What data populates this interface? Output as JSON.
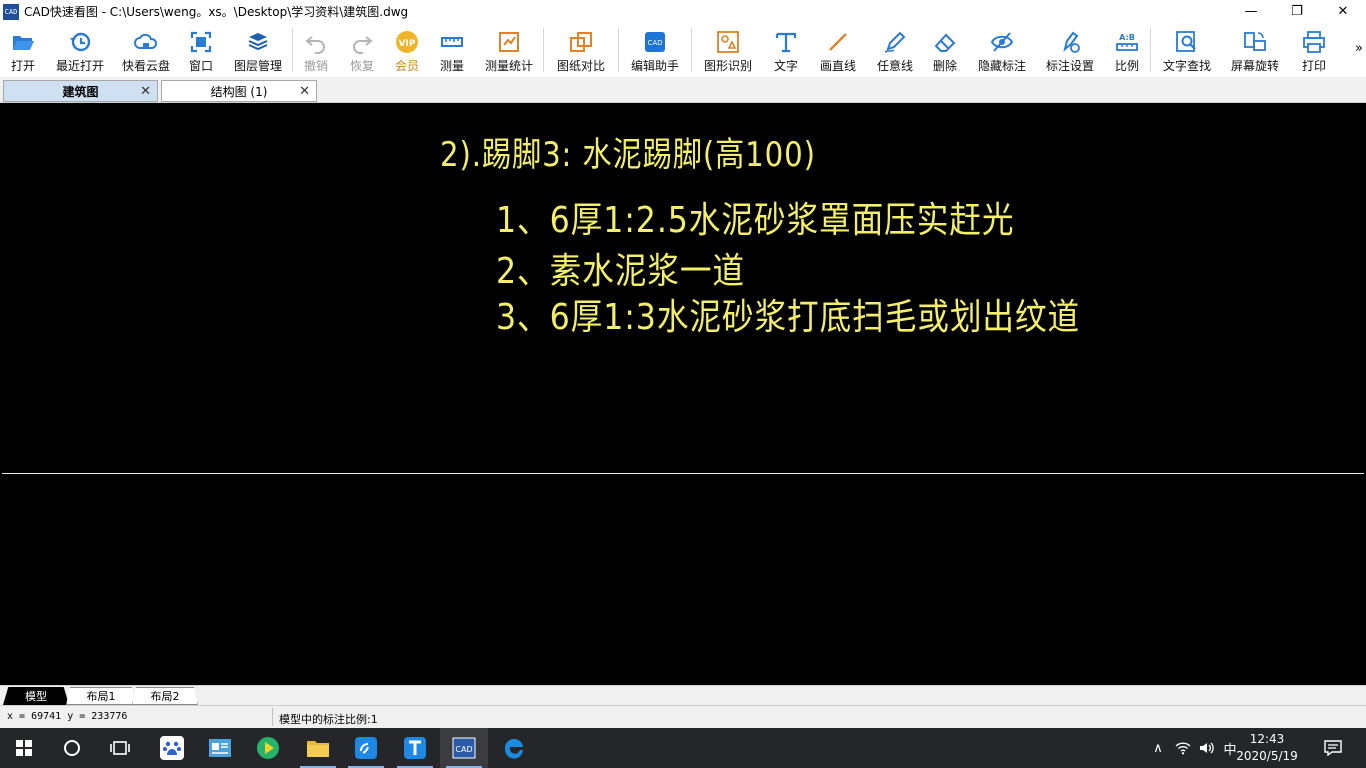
{
  "window": {
    "app_icon_text": "CAD",
    "title": "CAD快速看图 - C:\\Users\\weng。xs。\\Desktop\\学习资料\\建筑图.dwg",
    "minimize": "—",
    "maximize": "❐",
    "close": "✕"
  },
  "toolbar": {
    "open": "打开",
    "recent": "最近打开",
    "cloud": "快看云盘",
    "window": "窗口",
    "layers": "图层管理",
    "undo": "撤销",
    "redo": "恢复",
    "vip": "会员",
    "measure": "测量",
    "measure_stats": "测量统计",
    "compare": "图纸对比",
    "edit_assistant": "编辑助手",
    "shape_recognize": "图形识别",
    "text": "文字",
    "draw_line": "画直线",
    "freehand": "任意线",
    "delete": "删除",
    "hide_annotation": "隐藏标注",
    "annotation_settings": "标注设置",
    "scale": "比例",
    "text_search": "文字查找",
    "screen_rotate": "屏幕旋转",
    "print": "打印",
    "more": "»"
  },
  "doc_tabs": [
    {
      "label": "建筑图",
      "active": true
    },
    {
      "label": "结构图 (1)",
      "active": false
    }
  ],
  "drawing": {
    "title": "2).踢脚3: 水泥踢脚(高100)",
    "line1": "1、6厚1:2.5水泥砂浆罩面压实赶光",
    "line2": "2、素水泥浆一道",
    "line3": "3、6厚1:3水泥砂浆打底扫毛或划出纹道",
    "text_color": "#f3ef6a"
  },
  "layout_tabs": [
    {
      "label": "模型",
      "active": true
    },
    {
      "label": "布局1",
      "active": false
    },
    {
      "label": "布局2",
      "active": false
    }
  ],
  "status": {
    "coords": "x = 69741  y = 233776",
    "scale": "模型中的标注比例:1"
  },
  "taskbar": {
    "tray_chevron": "∧",
    "ime": "中",
    "time": "12:43",
    "date": "2020/5/19"
  }
}
